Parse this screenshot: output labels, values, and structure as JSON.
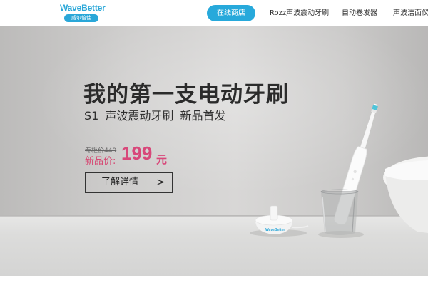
{
  "header": {
    "logo_text": "WaveBetter",
    "logo_sub": "威尔倍佳",
    "nav": {
      "store": "在线商店",
      "items": [
        "Rozz声波震动牙刷",
        "自动卷发器",
        "声波洁面仪"
      ]
    }
  },
  "hero": {
    "title": "我的第一支电动牙刷",
    "subtitle": "S1 声波震动牙刷  新品首发",
    "old_price": "专柜价449",
    "new_price_label": "新品价:",
    "new_price": "199",
    "new_price_unit": "元",
    "learn_more": "了解详情",
    "learn_more_arrow": ">",
    "charger_logo": "WaveBetter"
  },
  "colors": {
    "accent": "#27a9db",
    "price": "#d8487a",
    "title": "#2b2b2b"
  },
  "icons": {
    "arrow": "chevron-right-icon"
  }
}
